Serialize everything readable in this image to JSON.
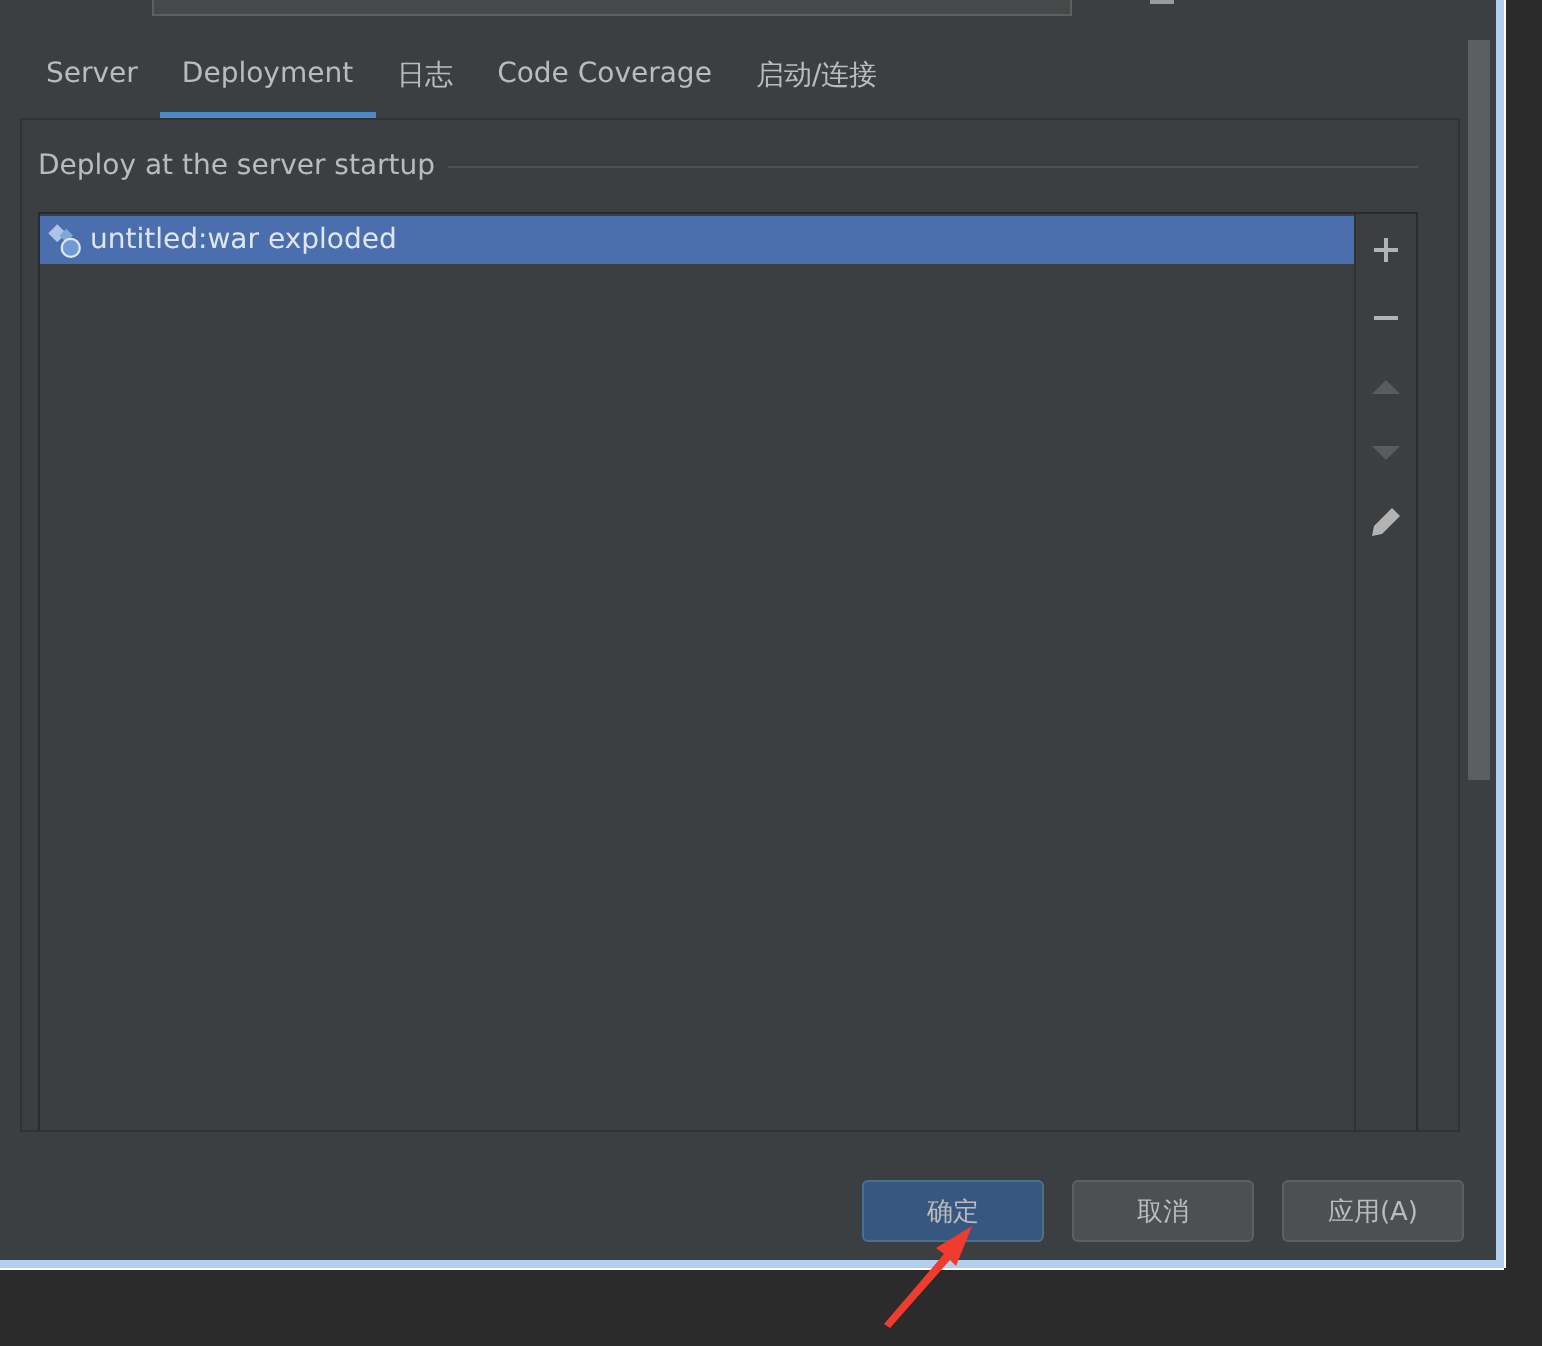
{
  "tabs": [
    {
      "label": "Server",
      "selected": false
    },
    {
      "label": "Deployment",
      "selected": true
    },
    {
      "label": "日志",
      "selected": false
    },
    {
      "label": "Code Coverage",
      "selected": false
    },
    {
      "label": "启动/连接",
      "selected": false
    }
  ],
  "section": {
    "title": "Deploy at the server startup"
  },
  "artifacts": [
    {
      "label": "untitled:war exploded",
      "selected": true
    }
  ],
  "toolbar": [
    {
      "kind": "add",
      "disabled": false
    },
    {
      "kind": "remove",
      "disabled": false
    },
    {
      "kind": "up",
      "disabled": true
    },
    {
      "kind": "down",
      "disabled": true
    },
    {
      "kind": "edit",
      "disabled": false
    }
  ],
  "buttons": [
    {
      "label": "确定",
      "kind": "default"
    },
    {
      "label": "取消",
      "kind": "normal"
    },
    {
      "label": "应用(A)",
      "kind": "normal"
    }
  ]
}
